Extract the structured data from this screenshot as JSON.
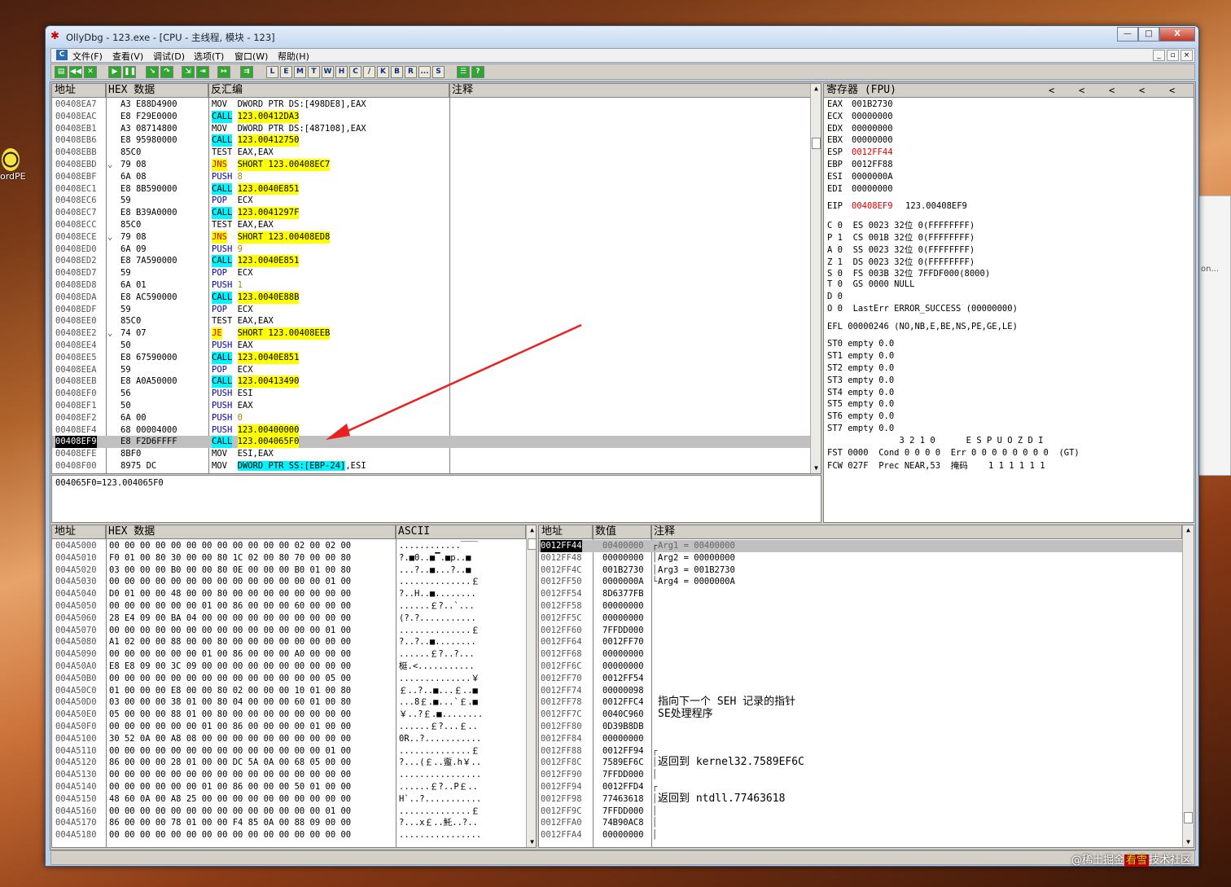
{
  "desktop": {
    "icon_label": "ordPE",
    "right_window_text": "on..."
  },
  "window": {
    "title": "OllyDbg - 123.exe - [CPU - 主线程, 模块 - 123]",
    "btn_min": "—",
    "btn_max": "□",
    "btn_close": "X"
  },
  "menu": {
    "items": [
      "文件(F)",
      "查看(V)",
      "调试(D)",
      "选项(T)",
      "窗口(W)",
      "帮助(H)"
    ]
  },
  "toolbar": {
    "letters": [
      "L",
      "E",
      "M",
      "T",
      "W",
      "H",
      "C",
      "/",
      "K",
      "B",
      "R",
      "...",
      "S"
    ]
  },
  "disasm": {
    "headers": {
      "addr": "地址",
      "hex": "HEX 数据",
      "asm": "反汇编",
      "comment": "注释"
    },
    "rows": [
      {
        "addr": "00408EA7",
        "mark": "",
        "hex": "A3 E88D4900",
        "op": "MOV",
        "arg": "DWORD PTR DS:[498DE8],EAX",
        "type": "mov"
      },
      {
        "addr": "00408EAC",
        "mark": "",
        "hex": "E8 F29E0000",
        "op": "CALL",
        "arg": "123.00412DA3",
        "type": "call"
      },
      {
        "addr": "00408EB1",
        "mark": "",
        "hex": "A3 08714800",
        "op": "MOV",
        "arg": "DWORD PTR DS:[487108],EAX",
        "type": "mov"
      },
      {
        "addr": "00408EB6",
        "mark": "",
        "hex": "E8 95980000",
        "op": "CALL",
        "arg": "123.00412750",
        "type": "call"
      },
      {
        "addr": "00408EBB",
        "mark": "",
        "hex": "85C0",
        "op": "TEST",
        "arg": "EAX,EAX",
        "type": "plain"
      },
      {
        "addr": "00408EBD",
        "mark": "⌄",
        "hex": "79 08",
        "op": "JNS",
        "arg": "SHORT 123.00408EC7",
        "type": "jmp"
      },
      {
        "addr": "00408EBF",
        "mark": "",
        "hex": "6A 08",
        "op": "PUSH",
        "arg": "8",
        "type": "push"
      },
      {
        "addr": "00408EC1",
        "mark": "",
        "hex": "E8 8B590000",
        "op": "CALL",
        "arg": "123.0040E851",
        "type": "call"
      },
      {
        "addr": "00408EC6",
        "mark": "",
        "hex": "59",
        "op": "POP",
        "arg": "ECX",
        "type": "pop"
      },
      {
        "addr": "00408EC7",
        "mark": "",
        "hex": "E8 B39A0000",
        "op": "CALL",
        "arg": "123.0041297F",
        "type": "call"
      },
      {
        "addr": "00408ECC",
        "mark": "",
        "hex": "85C0",
        "op": "TEST",
        "arg": "EAX,EAX",
        "type": "plain"
      },
      {
        "addr": "00408ECE",
        "mark": "⌄",
        "hex": "79 08",
        "op": "JNS",
        "arg": "SHORT 123.00408ED8",
        "type": "jmp"
      },
      {
        "addr": "00408ED0",
        "mark": "",
        "hex": "6A 09",
        "op": "PUSH",
        "arg": "9",
        "type": "push"
      },
      {
        "addr": "00408ED2",
        "mark": "",
        "hex": "E8 7A590000",
        "op": "CALL",
        "arg": "123.0040E851",
        "type": "call"
      },
      {
        "addr": "00408ED7",
        "mark": "",
        "hex": "59",
        "op": "POP",
        "arg": "ECX",
        "type": "pop"
      },
      {
        "addr": "00408ED8",
        "mark": "",
        "hex": "6A 01",
        "op": "PUSH",
        "arg": "1",
        "type": "push"
      },
      {
        "addr": "00408EDA",
        "mark": "",
        "hex": "E8 AC590000",
        "op": "CALL",
        "arg": "123.0040E88B",
        "type": "call"
      },
      {
        "addr": "00408EDF",
        "mark": "",
        "hex": "59",
        "op": "POP",
        "arg": "ECX",
        "type": "pop"
      },
      {
        "addr": "00408EE0",
        "mark": "",
        "hex": "85C0",
        "op": "TEST",
        "arg": "EAX,EAX",
        "type": "plain"
      },
      {
        "addr": "00408EE2",
        "mark": "⌄",
        "hex": "74 07",
        "op": "JE",
        "arg": "SHORT 123.00408EEB",
        "type": "jmp"
      },
      {
        "addr": "00408EE4",
        "mark": "",
        "hex": "50",
        "op": "PUSH",
        "arg": "EAX",
        "type": "pushreg"
      },
      {
        "addr": "00408EE5",
        "mark": "",
        "hex": "E8 67590000",
        "op": "CALL",
        "arg": "123.0040E851",
        "type": "call"
      },
      {
        "addr": "00408EEA",
        "mark": "",
        "hex": "59",
        "op": "POP",
        "arg": "ECX",
        "type": "pop"
      },
      {
        "addr": "00408EEB",
        "mark": "",
        "hex": "E8 A0A50000",
        "op": "CALL",
        "arg": "123.00413490",
        "type": "call"
      },
      {
        "addr": "00408EF0",
        "mark": "",
        "hex": "56",
        "op": "PUSH",
        "arg": "ESI",
        "type": "pushreg"
      },
      {
        "addr": "00408EF1",
        "mark": "",
        "hex": "50",
        "op": "PUSH",
        "arg": "EAX",
        "type": "pushreg"
      },
      {
        "addr": "00408EF2",
        "mark": "",
        "hex": "6A 00",
        "op": "PUSH",
        "arg": "0",
        "type": "push"
      },
      {
        "addr": "00408EF4",
        "mark": "",
        "hex": "68 00004000",
        "op": "PUSH",
        "arg": "123.00400000",
        "type": "pushaddr"
      },
      {
        "addr": "00408EF9",
        "mark": "",
        "hex": "E8 F2D6FFFF",
        "op": "CALL",
        "arg": "123.004065F0",
        "type": "call",
        "current": true
      },
      {
        "addr": "00408EFE",
        "mark": "",
        "hex": "8BF0",
        "op": "MOV",
        "arg": "ESI,EAX",
        "type": "plain"
      },
      {
        "addr": "00408F00",
        "mark": "",
        "hex": "8975 DC",
        "op": "MOV",
        "arg": "DWORD PTR SS:[EBP-24],ESI",
        "type": "movss"
      }
    ],
    "info": "004065F0=123.004065F0"
  },
  "registers": {
    "title": "寄存器 (FPU)",
    "nav": [
      "<",
      "<",
      "<",
      "<",
      "<"
    ],
    "gp": [
      {
        "name": "EAX",
        "val": "001B2730",
        "red": false
      },
      {
        "name": "ECX",
        "val": "00000000",
        "red": false
      },
      {
        "name": "EDX",
        "val": "00000000",
        "red": false
      },
      {
        "name": "EBX",
        "val": "00000000",
        "red": false
      },
      {
        "name": "ESP",
        "val": "0012FF44",
        "red": true
      },
      {
        "name": "EBP",
        "val": "0012FF88",
        "red": false
      },
      {
        "name": "ESI",
        "val": "0000000A",
        "red": false
      },
      {
        "name": "EDI",
        "val": "00000000",
        "red": false
      }
    ],
    "eip": {
      "name": "EIP",
      "val": "00408EF9",
      "extra": "123.00408EF9"
    },
    "flags": [
      "C 0  ES 0023 32位 0(FFFFFFFF)",
      "P 1  CS 001B 32位 0(FFFFFFFF)",
      "A 0  SS 0023 32位 0(FFFFFFFF)",
      "Z 1  DS 0023 32位 0(FFFFFFFF)",
      "S 0  FS 003B 32位 7FFDF000(8000)",
      "T 0  GS 0000 NULL",
      "D 0",
      "O 0  LastErr ERROR_SUCCESS (00000000)"
    ],
    "efl": "EFL 00000246 (NO,NB,E,BE,NS,PE,GE,LE)",
    "fpu": [
      "ST0 empty 0.0",
      "ST1 empty 0.0",
      "ST2 empty 0.0",
      "ST3 empty 0.0",
      "ST4 empty 0.0",
      "ST5 empty 0.0",
      "ST6 empty 0.0",
      "ST7 empty 0.0"
    ],
    "fpu_bits": "              3 2 1 0      E S P U O Z D I",
    "fst": "FST 0000  Cond 0 0 0 0  Err 0 0 0 0 0 0 0 0  (GT)",
    "fcw": "FCW 027F  Prec NEAR,53  掩码    1 1 1 1 1 1"
  },
  "dump": {
    "headers": {
      "addr": "地址",
      "hex": "HEX 数据",
      "ascii": "ASCII"
    },
    "rows": [
      {
        "addr": "004A5000",
        "hex": "00 00 00 00 00 00 00 00 00 00 00 00 02 00 02 00",
        "ascii": "............￣￣"
      },
      {
        "addr": "004A5010",
        "hex": "F0 01 00 80 30 00 00 80 1C 02 00 80 70 00 00 80",
        "ascii": "?.■0..■▔.■p..■"
      },
      {
        "addr": "004A5020",
        "hex": "03 00 00 00 B0 00 00 80 0E 00 00 00 B0 01 00 80",
        "ascii": "...?..■...?..■"
      },
      {
        "addr": "004A5030",
        "hex": "00 00 00 00 00 00 00 00 00 00 00 00 00 00 01 00",
        "ascii": "..............￡"
      },
      {
        "addr": "004A5040",
        "hex": "D0 01 00 00 48 00 00 80 00 00 00 00 00 00 00 00",
        "ascii": "?..H..■........"
      },
      {
        "addr": "004A5050",
        "hex": "00 00 00 00 00 00 01 00 86 00 00 00 60 00 00 00",
        "ascii": "......￡?..`..."
      },
      {
        "addr": "004A5060",
        "hex": "28 E4 09 00 BA 04 00 00 00 00 00 00 00 00 00 00",
        "ascii": "(?.?..........."
      },
      {
        "addr": "004A5070",
        "hex": "00 00 00 00 00 00 00 00 00 00 00 00 00 00 01 00",
        "ascii": "..............￡"
      },
      {
        "addr": "004A5080",
        "hex": "A1 02 00 00 88 00 00 80 00 00 00 00 00 00 00 00",
        "ascii": "?..?..■........"
      },
      {
        "addr": "004A5090",
        "hex": "00 00 00 00 00 00 01 00 86 00 00 00 A0 00 00 00",
        "ascii": "......￡?..?..."
      },
      {
        "addr": "004A50A0",
        "hex": "E8 E8 09 00 3C 09 00 00 00 00 00 00 00 00 00 00",
        "ascii": "梃.<..........."
      },
      {
        "addr": "004A50B0",
        "hex": "00 00 00 00 00 00 00 00 00 00 00 00 00 00 05 00",
        "ascii": "..............￥"
      },
      {
        "addr": "004A50C0",
        "hex": "01 00 00 00 E8 00 00 80 02 00 00 00 10 01 00 80",
        "ascii": "￡..?..■...￡..■"
      },
      {
        "addr": "004A50D0",
        "hex": "03 00 00 00 38 01 00 80 04 00 00 00 60 01 00 80",
        "ascii": "...8￡.■...`￡.■"
      },
      {
        "addr": "004A50E0",
        "hex": "05 00 00 00 88 01 00 80 00 00 00 00 00 00 00 00",
        "ascii": "￥..?￡.■........"
      },
      {
        "addr": "004A50F0",
        "hex": "00 00 00 00 00 00 01 00 86 00 00 00 00 01 00 00",
        "ascii": "......￡?...￡.."
      },
      {
        "addr": "004A5100",
        "hex": "30 52 0A 00 A8 08 00 00 00 00 00 00 00 00 00 00",
        "ascii": "0R..?..........."
      },
      {
        "addr": "004A5110",
        "hex": "00 00 00 00 00 00 00 00 00 00 00 00 00 00 01 00",
        "ascii": "..............￡"
      },
      {
        "addr": "004A5120",
        "hex": "86 00 00 00 28 01 00 00 DC 5A 0A 00 68 05 00 00",
        "ascii": "?...(￡..躗.h￥.."
      },
      {
        "addr": "004A5130",
        "hex": "00 00 00 00 00 00 00 00 00 00 00 00 00 00 00 00",
        "ascii": "................"
      },
      {
        "addr": "004A5140",
        "hex": "00 00 00 00 00 00 01 00 86 00 00 00 50 01 00 00",
        "ascii": "......￡?..P￡.."
      },
      {
        "addr": "004A5150",
        "hex": "48 60 0A 00 A8 25 00 00 00 00 00 00 00 00 00 00",
        "ascii": "H`..?..........."
      },
      {
        "addr": "004A5160",
        "hex": "00 00 00 00 00 00 00 00 00 00 00 00 00 00 01 00",
        "ascii": "..............￡"
      },
      {
        "addr": "004A5170",
        "hex": "86 00 00 00 78 01 00 00 F4 85 0A 00 88 09 00 00",
        "ascii": "?...x￡..魠..?.."
      },
      {
        "addr": "004A5180",
        "hex": "00 00 00 00 00 00 00 00 00 00 00 00 00 00 00 00",
        "ascii": "................"
      }
    ]
  },
  "stack": {
    "headers": {
      "addr": "地址",
      "val": "数值",
      "comment": "注释"
    },
    "rows": [
      {
        "addr": "0012FF44",
        "val": "00400000",
        "brace": "┌",
        "comment": "Arg1 = 00400000",
        "current": true
      },
      {
        "addr": "0012FF48",
        "val": "00000000",
        "brace": "│",
        "comment": "Arg2 = 00000000"
      },
      {
        "addr": "0012FF4C",
        "val": "001B2730",
        "brace": "│",
        "comment": "Arg3 = 001B2730"
      },
      {
        "addr": "0012FF50",
        "val": "0000000A",
        "brace": "└",
        "comment": "Arg4 = 0000000A"
      },
      {
        "addr": "0012FF54",
        "val": "8D6377FB",
        "brace": "",
        "comment": ""
      },
      {
        "addr": "0012FF58",
        "val": "00000000",
        "brace": "",
        "comment": ""
      },
      {
        "addr": "0012FF5C",
        "val": "00000000",
        "brace": "",
        "comment": ""
      },
      {
        "addr": "0012FF60",
        "val": "7FFDD000",
        "brace": "",
        "comment": ""
      },
      {
        "addr": "0012FF64",
        "val": "0012FF70",
        "brace": "",
        "comment": ""
      },
      {
        "addr": "0012FF68",
        "val": "00000000",
        "brace": "",
        "comment": ""
      },
      {
        "addr": "0012FF6C",
        "val": "00000000",
        "brace": "",
        "comment": ""
      },
      {
        "addr": "0012FF70",
        "val": "0012FF54",
        "brace": "",
        "comment": ""
      },
      {
        "addr": "0012FF74",
        "val": "00000098",
        "brace": "",
        "comment": ""
      },
      {
        "addr": "0012FF78",
        "val": "0012FFC4",
        "brace": "",
        "comment": "指向下一个 SEH 记录的指针"
      },
      {
        "addr": "0012FF7C",
        "val": "0040C960",
        "brace": "",
        "comment": "SE处理程序"
      },
      {
        "addr": "0012FF80",
        "val": "0D39B8DB",
        "brace": "",
        "comment": ""
      },
      {
        "addr": "0012FF84",
        "val": "00000000",
        "brace": "",
        "comment": ""
      },
      {
        "addr": "0012FF88",
        "val": "0012FF94",
        "brace": "┌",
        "comment": ""
      },
      {
        "addr": "0012FF8C",
        "val": "7589EF6C",
        "brace": "│",
        "comment": "返回到 kernel32.7589EF6C"
      },
      {
        "addr": "0012FF90",
        "val": "7FFDD000",
        "brace": "│",
        "comment": ""
      },
      {
        "addr": "0012FF94",
        "val": "0012FFD4",
        "brace": "┌",
        "comment": ""
      },
      {
        "addr": "0012FF98",
        "val": "77463618",
        "brace": "│",
        "comment": "返回到 ntdll.77463618"
      },
      {
        "addr": "0012FF9C",
        "val": "7FFDD000",
        "brace": "│",
        "comment": ""
      },
      {
        "addr": "0012FFA0",
        "val": "74B90AC8",
        "brace": "│",
        "comment": ""
      },
      {
        "addr": "0012FFA4",
        "val": "00000000",
        "brace": "│",
        "comment": ""
      }
    ]
  },
  "watermark": {
    "prefix": "@稀土掘金",
    "badge": "看雪",
    "suffix": "技术社区"
  }
}
